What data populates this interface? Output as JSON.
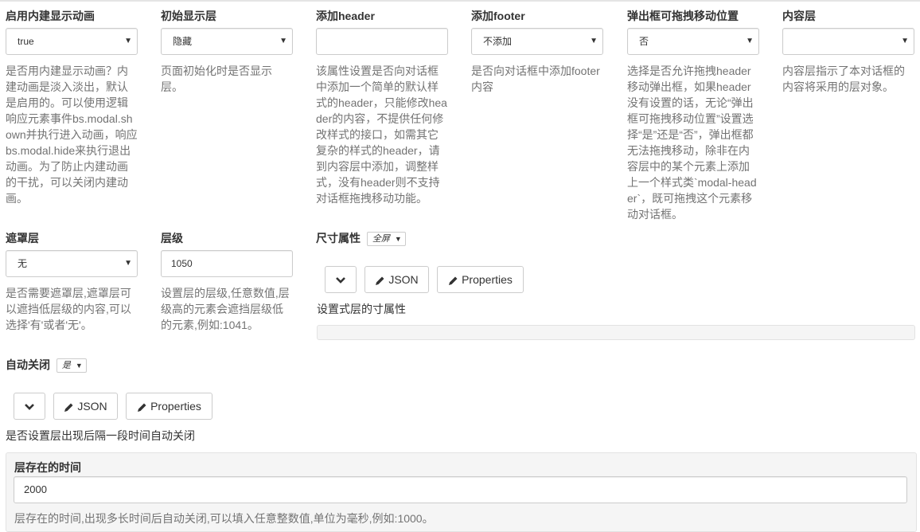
{
  "fields": {
    "animation": {
      "label": "启用内建显示动画",
      "value": "true",
      "help": "是否用内建显示动画？内建动画是淡入淡出，默认是启用的。可以使用逻辑响应元素事件bs.modal.shown并执行进入动画，响应bs.modal.hide来执行退出动画。为了防止内建动画的干扰，可以关闭内建动画。"
    },
    "initial": {
      "label": "初始显示层",
      "value": "隐藏",
      "help": "页面初始化时是否显示层。"
    },
    "header": {
      "label": "添加header",
      "value": "",
      "help": "该属性设置是否向对话框中添加一个简单的默认样式的header，只能修改header的内容，不提供任何修改样式的接口，如需其它复杂的样式的header，请到内容层中添加，调整样式，没有header则不支持对话框拖拽移动功能。"
    },
    "footer": {
      "label": "添加footer",
      "value": "不添加",
      "help": "是否向对话框中添加footer内容"
    },
    "draggable": {
      "label": "弹出框可拖拽移动位置",
      "value": "否",
      "help": "选择是否允许拖拽header移动弹出框，如果header没有设置的话，无论“弹出框可拖拽移动位置”设置选择“是”还是“否”，弹出框都无法拖拽移动，除非在内容层中的某个元素上添加上一个样式类`modal-header`，既可拖拽这个元素移动对话框。"
    },
    "content": {
      "label": "内容层",
      "value": "",
      "help": "内容层指示了本对话框的内容将采用的层对象。"
    },
    "mask": {
      "label": "遮罩层",
      "value": "无",
      "help": "是否需要遮罩层,遮罩层可以遮挡低层级的内容,可以选择'有'或者'无'。"
    },
    "zindex": {
      "label": "层级",
      "value": "1050",
      "help": "设置层的层级,任意数值,层级高的元素会遮挡层级低的元素,例如:1041。"
    },
    "size": {
      "label": "尺寸属性",
      "mode": "全屏",
      "help": "设置式层的寸属性"
    },
    "autoclose": {
      "label": "自动关闭",
      "mode": "是",
      "help": "是否设置层出现后隔一段时间自动关闭"
    },
    "duration": {
      "label": "层存在的时间",
      "value": "2000",
      "help": "层存在的时间,出现多长时间后自动关闭,可以填入任意整数值,单位为毫秒,例如:1000。"
    }
  },
  "buttons": {
    "json": "JSON",
    "properties": "Properties"
  },
  "icons": {
    "toggle": "chevron-down-icon",
    "edit": "pencil-icon",
    "caret": "caret-down-icon"
  }
}
